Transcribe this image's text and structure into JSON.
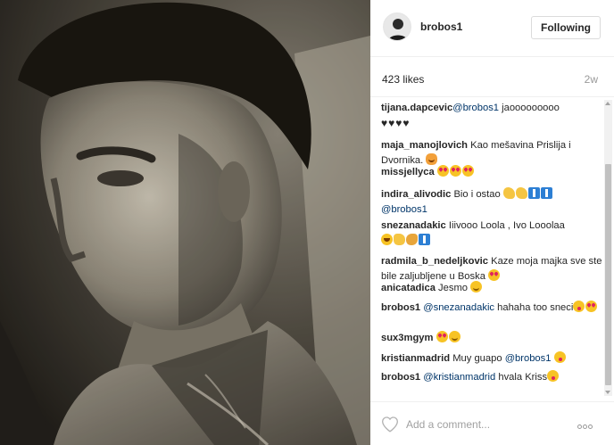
{
  "header": {
    "username": "brobos1",
    "follow_label": "Following"
  },
  "meta": {
    "likes": "423 likes",
    "age": "2w"
  },
  "comments": [
    {
      "user": "tijana.dapcevic",
      "parts": [
        {
          "t": "mention",
          "v": "@brobos1"
        },
        {
          "t": "text",
          "v": " jaooooooooo"
        },
        {
          "t": "br"
        },
        {
          "t": "hearts",
          "v": "♥♥♥♥"
        }
      ]
    },
    {
      "user": "maja_manojlovich",
      "parts": [
        {
          "t": "text",
          "v": " Kao mešavina Prislija i Dvornika. "
        },
        {
          "t": "emoji",
          "v": "cat"
        }
      ]
    },
    {
      "user": "missjellyca",
      "parts": [
        {
          "t": "text",
          "v": " "
        },
        {
          "t": "emoji",
          "v": "face"
        },
        {
          "t": "emoji",
          "v": "face"
        },
        {
          "t": "emoji",
          "v": "face"
        }
      ]
    },
    {
      "user": "indira_alivodic",
      "parts": [
        {
          "t": "text",
          "v": " Bio i ostao "
        },
        {
          "t": "emoji",
          "v": "muscle"
        },
        {
          "t": "emoji",
          "v": "muscle"
        },
        {
          "t": "emoji",
          "v": "anchor"
        },
        {
          "t": "emoji",
          "v": "anchor"
        },
        {
          "t": "br"
        },
        {
          "t": "mention",
          "v": "@brobos1"
        }
      ]
    },
    {
      "user": "snezanadakic",
      "parts": [
        {
          "t": "text",
          "v": " Iiivooo Loola , Ivo Looolaa "
        },
        {
          "t": "br"
        },
        {
          "t": "emoji",
          "v": "laugh"
        },
        {
          "t": "emoji",
          "v": "thumb"
        },
        {
          "t": "emoji",
          "v": "clap"
        },
        {
          "t": "emoji",
          "v": "anchor"
        }
      ]
    },
    {
      "user": "radmila_b_nedeljkovic",
      "parts": [
        {
          "t": "text",
          "v": " Kaze moja majka sve ste bile zaljubljene u Boska "
        },
        {
          "t": "emoji",
          "v": "face"
        }
      ]
    },
    {
      "user": "anicatadica",
      "parts": [
        {
          "t": "text",
          "v": " Jesmo "
        },
        {
          "t": "emoji",
          "v": "smile"
        }
      ]
    },
    {
      "user": "brobos1",
      "parts": [
        {
          "t": "text",
          "v": " "
        },
        {
          "t": "mention",
          "v": "@snezanadakic"
        },
        {
          "t": "text",
          "v": " hahaha too sneci"
        },
        {
          "t": "emoji",
          "v": "wink"
        },
        {
          "t": "emoji",
          "v": "face"
        }
      ]
    },
    {
      "user": "sux3mgym",
      "parts": [
        {
          "t": "text",
          "v": " "
        },
        {
          "t": "emoji",
          "v": "face"
        },
        {
          "t": "emoji",
          "v": "smile"
        }
      ]
    },
    {
      "user": "kristianmadrid",
      "parts": [
        {
          "t": "text",
          "v": " Muy guapo "
        },
        {
          "t": "mention",
          "v": "@brobos1"
        },
        {
          "t": "text",
          "v": " "
        },
        {
          "t": "emoji",
          "v": "wink"
        }
      ]
    },
    {
      "user": "brobos1",
      "parts": [
        {
          "t": "text",
          "v": " "
        },
        {
          "t": "mention",
          "v": "@kristianmadrid"
        },
        {
          "t": "text",
          "v": " hvala Kriss"
        },
        {
          "t": "emoji",
          "v": "wink"
        }
      ]
    }
  ],
  "footer": {
    "comment_placeholder": "Add a comment..."
  },
  "colors": {
    "mention": "#003569",
    "muted": "#999999",
    "border": "#efefef"
  },
  "icons": {
    "heart": "heart-outline-icon",
    "more": "more-options-icon"
  }
}
